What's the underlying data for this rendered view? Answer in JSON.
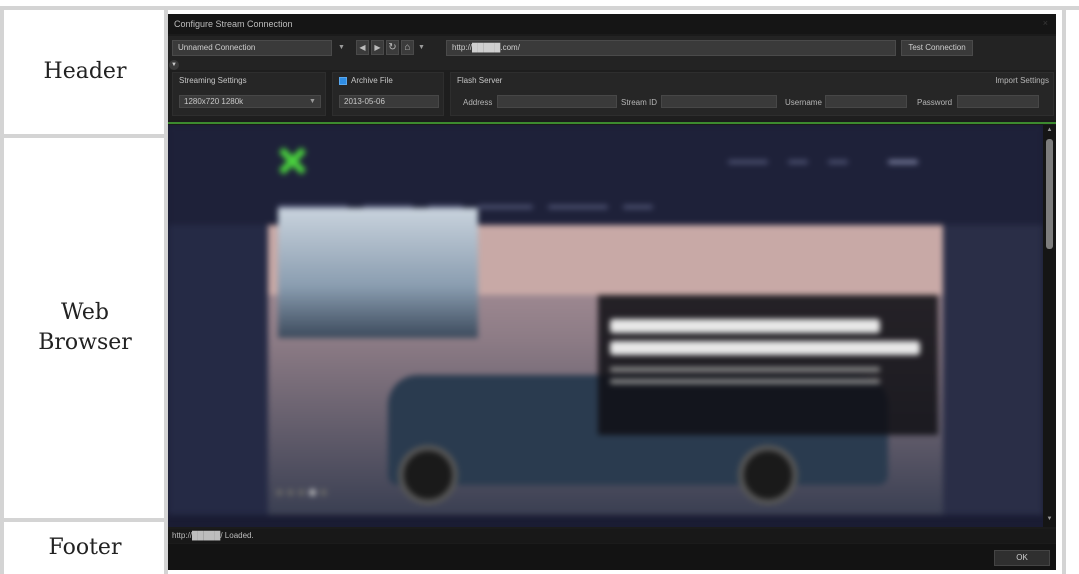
{
  "labels": {
    "header": "Header",
    "web_browser": "Web Browser",
    "footer": "Footer"
  },
  "window": {
    "title": "Configure Stream Connection",
    "close_glyph": "×"
  },
  "toolbar": {
    "connection_name": "Unnamed Connection",
    "url": "http://█████.com/",
    "test_connection": "Test Connection",
    "back_icon": "chevron-left-icon",
    "forward_icon": "chevron-right-icon",
    "refresh_icon": "refresh-icon",
    "home_icon": "home-icon"
  },
  "streaming_settings": {
    "title": "Streaming Settings",
    "preset": "1280x720 1280k"
  },
  "archive": {
    "label": "Archive File",
    "checked": true,
    "value": "2013-05-06"
  },
  "flash_server": {
    "title": "Flash Server",
    "import_settings": "Import Settings",
    "address_label": "Address",
    "address_value": "",
    "stream_id_label": "Stream ID",
    "stream_id_value": "",
    "username_label": "Username",
    "username_value": "",
    "password_label": "Password",
    "password_value": ""
  },
  "status": {
    "text": "http://█████/ Loaded."
  },
  "footer": {
    "ok_label": "OK"
  },
  "colors": {
    "accent_green": "#3c8a2f",
    "checkbox_blue": "#2f8de4"
  }
}
